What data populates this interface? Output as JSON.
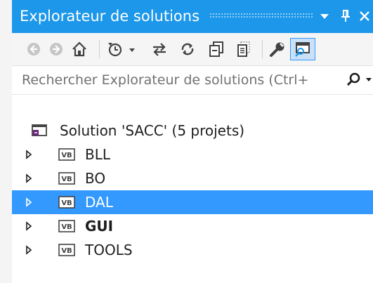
{
  "panel": {
    "title": "Explorateur de solutions"
  },
  "toolbar": {
    "buttons": [
      {
        "name": "back-button",
        "icon": "back-arrow-icon"
      },
      {
        "name": "forward-button",
        "icon": "forward-arrow-icon"
      },
      {
        "name": "home-button",
        "icon": "home-icon"
      },
      {
        "name": "pending-changes-button",
        "icon": "history-icon"
      },
      {
        "name": "sync-button",
        "icon": "sync-arrows-icon"
      },
      {
        "name": "refresh-button",
        "icon": "refresh-icon"
      },
      {
        "name": "collapse-all-button",
        "icon": "collapse-all-icon"
      },
      {
        "name": "show-all-files-button",
        "icon": "show-all-files-icon"
      },
      {
        "name": "properties-button",
        "icon": "wrench-icon"
      },
      {
        "name": "preview-button",
        "icon": "preview-icon",
        "active": true
      }
    ]
  },
  "search": {
    "placeholder": "Rechercher Explorateur de solutions (Ctrl+"
  },
  "tree": {
    "solution": {
      "label": "Solution 'SACC' (5 projets)"
    },
    "projects": [
      {
        "label": "BLL",
        "badge": "VB",
        "selected": false,
        "bold": false
      },
      {
        "label": "BO",
        "badge": "VB",
        "selected": false,
        "bold": false
      },
      {
        "label": "DAL",
        "badge": "VB",
        "selected": true,
        "bold": false
      },
      {
        "label": "GUI",
        "badge": "VB",
        "selected": false,
        "bold": true
      },
      {
        "label": "TOOLS",
        "badge": "VB",
        "selected": false,
        "bold": false
      }
    ]
  },
  "colors": {
    "title_bar": "#1c97ea",
    "selection": "#3399ff",
    "panel_bg": "#f5f5f5"
  }
}
